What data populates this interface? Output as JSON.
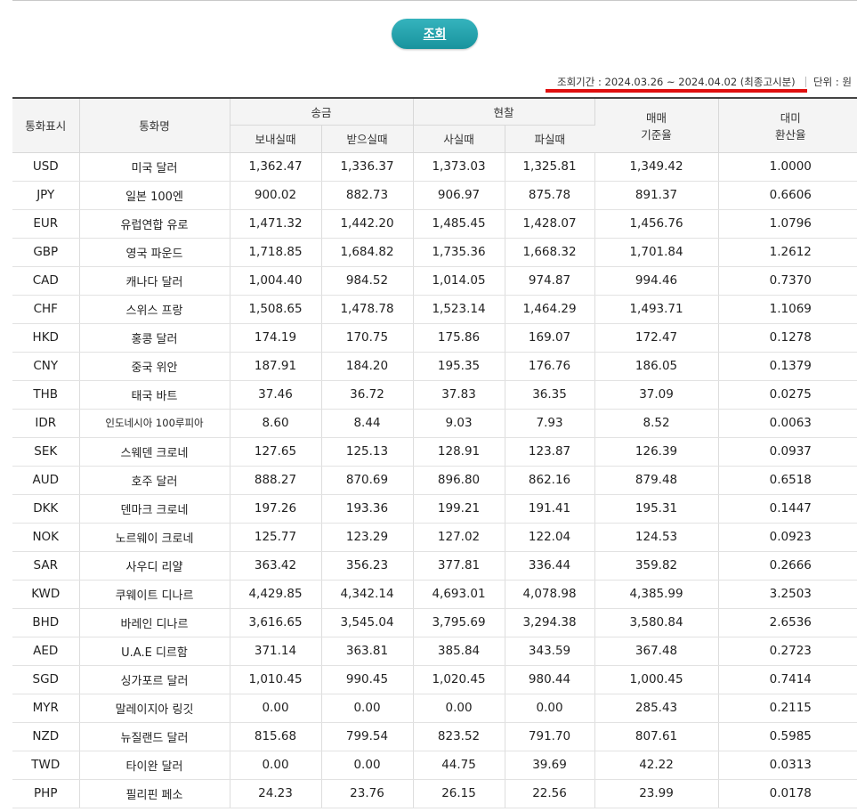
{
  "search_button": {
    "label": "조회"
  },
  "period": {
    "text": "조회기간 : 2024.03.26 ~ 2024.04.02 (최종고시분)",
    "unit": "단위 : 원"
  },
  "table": {
    "headers": {
      "currency_code": "통화표시",
      "currency_name": "통화명",
      "remit_group": "송금",
      "send": "보내실때",
      "receive": "받으실때",
      "cash_group": "현찰",
      "buy": "사실때",
      "sell": "파실때",
      "base_rate": "매매\n기준율",
      "usd_rate": "대미\n환산율"
    },
    "rows": [
      {
        "code": "USD",
        "name": "미국 달러",
        "send": "1,362.47",
        "receive": "1,336.37",
        "buy": "1,373.03",
        "sell": "1,325.81",
        "base": "1,349.42",
        "usd": "1.0000"
      },
      {
        "code": "JPY",
        "name": "일본 100엔",
        "send": "900.02",
        "receive": "882.73",
        "buy": "906.97",
        "sell": "875.78",
        "base": "891.37",
        "usd": "0.6606"
      },
      {
        "code": "EUR",
        "name": "유럽연합 유로",
        "send": "1,471.32",
        "receive": "1,442.20",
        "buy": "1,485.45",
        "sell": "1,428.07",
        "base": "1,456.76",
        "usd": "1.0796"
      },
      {
        "code": "GBP",
        "name": "영국 파운드",
        "send": "1,718.85",
        "receive": "1,684.82",
        "buy": "1,735.36",
        "sell": "1,668.32",
        "base": "1,701.84",
        "usd": "1.2612"
      },
      {
        "code": "CAD",
        "name": "캐나다 달러",
        "send": "1,004.40",
        "receive": "984.52",
        "buy": "1,014.05",
        "sell": "974.87",
        "base": "994.46",
        "usd": "0.7370"
      },
      {
        "code": "CHF",
        "name": "스위스 프랑",
        "send": "1,508.65",
        "receive": "1,478.78",
        "buy": "1,523.14",
        "sell": "1,464.29",
        "base": "1,493.71",
        "usd": "1.1069"
      },
      {
        "code": "HKD",
        "name": "홍콩 달러",
        "send": "174.19",
        "receive": "170.75",
        "buy": "175.86",
        "sell": "169.07",
        "base": "172.47",
        "usd": "0.1278"
      },
      {
        "code": "CNY",
        "name": "중국 위안",
        "send": "187.91",
        "receive": "184.20",
        "buy": "195.35",
        "sell": "176.76",
        "base": "186.05",
        "usd": "0.1379"
      },
      {
        "code": "THB",
        "name": "태국 바트",
        "send": "37.46",
        "receive": "36.72",
        "buy": "37.83",
        "sell": "36.35",
        "base": "37.09",
        "usd": "0.0275"
      },
      {
        "code": "IDR",
        "name": "인도네시아 100루피아",
        "send": "8.60",
        "receive": "8.44",
        "buy": "9.03",
        "sell": "7.93",
        "base": "8.52",
        "usd": "0.0063"
      },
      {
        "code": "SEK",
        "name": "스웨덴 크로네",
        "send": "127.65",
        "receive": "125.13",
        "buy": "128.91",
        "sell": "123.87",
        "base": "126.39",
        "usd": "0.0937"
      },
      {
        "code": "AUD",
        "name": "호주 달러",
        "send": "888.27",
        "receive": "870.69",
        "buy": "896.80",
        "sell": "862.16",
        "base": "879.48",
        "usd": "0.6518"
      },
      {
        "code": "DKK",
        "name": "덴마크 크로네",
        "send": "197.26",
        "receive": "193.36",
        "buy": "199.21",
        "sell": "191.41",
        "base": "195.31",
        "usd": "0.1447"
      },
      {
        "code": "NOK",
        "name": "노르웨이 크로네",
        "send": "125.77",
        "receive": "123.29",
        "buy": "127.02",
        "sell": "122.04",
        "base": "124.53",
        "usd": "0.0923"
      },
      {
        "code": "SAR",
        "name": "사우디 리얄",
        "send": "363.42",
        "receive": "356.23",
        "buy": "377.81",
        "sell": "336.44",
        "base": "359.82",
        "usd": "0.2666"
      },
      {
        "code": "KWD",
        "name": "쿠웨이트 디나르",
        "send": "4,429.85",
        "receive": "4,342.14",
        "buy": "4,693.01",
        "sell": "4,078.98",
        "base": "4,385.99",
        "usd": "3.2503"
      },
      {
        "code": "BHD",
        "name": "바레인 디나르",
        "send": "3,616.65",
        "receive": "3,545.04",
        "buy": "3,795.69",
        "sell": "3,294.38",
        "base": "3,580.84",
        "usd": "2.6536"
      },
      {
        "code": "AED",
        "name": "U.A.E 디르함",
        "send": "371.14",
        "receive": "363.81",
        "buy": "385.84",
        "sell": "343.59",
        "base": "367.48",
        "usd": "0.2723"
      },
      {
        "code": "SGD",
        "name": "싱가포르 달러",
        "send": "1,010.45",
        "receive": "990.45",
        "buy": "1,020.45",
        "sell": "980.44",
        "base": "1,000.45",
        "usd": "0.7414"
      },
      {
        "code": "MYR",
        "name": "말레이지아 링깃",
        "send": "0.00",
        "receive": "0.00",
        "buy": "0.00",
        "sell": "0.00",
        "base": "285.43",
        "usd": "0.2115"
      },
      {
        "code": "NZD",
        "name": "뉴질랜드 달러",
        "send": "815.68",
        "receive": "799.54",
        "buy": "823.52",
        "sell": "791.70",
        "base": "807.61",
        "usd": "0.5985"
      },
      {
        "code": "TWD",
        "name": "타이완 달러",
        "send": "0.00",
        "receive": "0.00",
        "buy": "44.75",
        "sell": "39.69",
        "base": "42.22",
        "usd": "0.0313"
      },
      {
        "code": "PHP",
        "name": "필리핀 페소",
        "send": "24.23",
        "receive": "23.76",
        "buy": "26.15",
        "sell": "22.56",
        "base": "23.99",
        "usd": "0.0178"
      }
    ]
  },
  "colors": {
    "button": "#1fa2ac",
    "underline": "#e01010"
  }
}
